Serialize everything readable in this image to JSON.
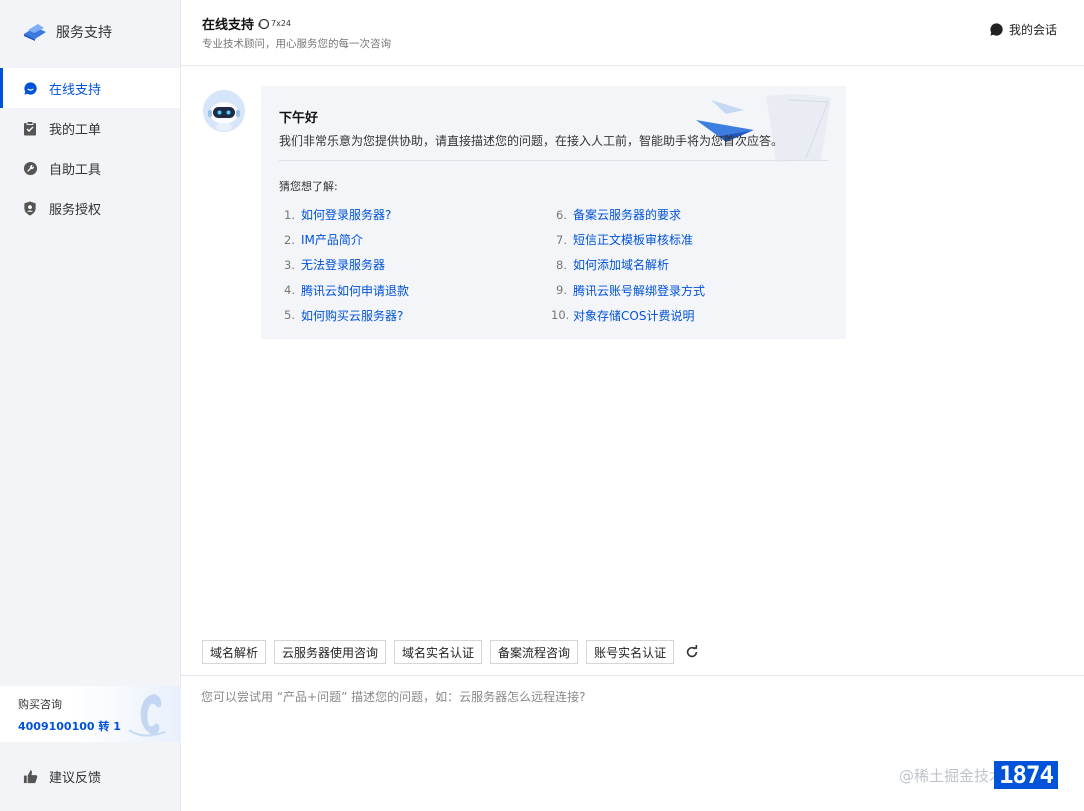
{
  "brand": {
    "name": "服务支持",
    "logo_icon": "cloud-logo-icon"
  },
  "sidebar": {
    "items": [
      {
        "label": "在线支持",
        "icon": "chat-bubble-icon",
        "active": true
      },
      {
        "label": "我的工单",
        "icon": "clipboard-icon",
        "active": false
      },
      {
        "label": "自助工具",
        "icon": "wrench-icon",
        "active": false
      },
      {
        "label": "服务授权",
        "icon": "shield-user-icon",
        "active": false
      }
    ],
    "hotline": {
      "label": "购买咨询",
      "number": "4009100100 转 1"
    },
    "feedback": {
      "label": "建议反馈",
      "icon": "thumbs-up-icon"
    }
  },
  "header": {
    "title": "在线支持",
    "badge": "7x24",
    "subtitle": "专业技术顾问，用心服务您的每一次咨询",
    "my_sessions": "我的会话"
  },
  "chat": {
    "greeting": "下午好",
    "intro": "我们非常乐意为您提供协助，请直接描述您的问题，在接入人工前，智能助手将为您首次应答。",
    "guess_label": "猜您想了解:",
    "questions_left": [
      {
        "num": "1.",
        "text": "如何登录服务器?"
      },
      {
        "num": "2.",
        "text": "IM产品简介"
      },
      {
        "num": "3.",
        "text": "无法登录服务器"
      },
      {
        "num": "4.",
        "text": "腾讯云如何申请退款"
      },
      {
        "num": "5.",
        "text": "如何购买云服务器?"
      }
    ],
    "questions_right": [
      {
        "num": "6.",
        "text": "备案云服务器的要求"
      },
      {
        "num": "7.",
        "text": "短信正文模板审核标准"
      },
      {
        "num": "8.",
        "text": "如何添加域名解析"
      },
      {
        "num": "9.",
        "text": "腾讯云账号解绑登录方式"
      },
      {
        "num": "10.",
        "text": "对象存储COS计费说明"
      }
    ]
  },
  "quick_tags": [
    "域名解析",
    "云服务器使用咨询",
    "域名实名认证",
    "备案流程咨询",
    "账号实名认证"
  ],
  "input": {
    "placeholder": "您可以尝试用 “产品+问题” 描述您的问题，如：云服务器怎么远程连接?"
  },
  "watermark": "@稀土掘金技术社区",
  "corner_badge": "1874",
  "colors": {
    "accent": "#0052d9",
    "sidebar_bg": "#f2f4f7",
    "bubble_bg": "#f3f5f8"
  }
}
